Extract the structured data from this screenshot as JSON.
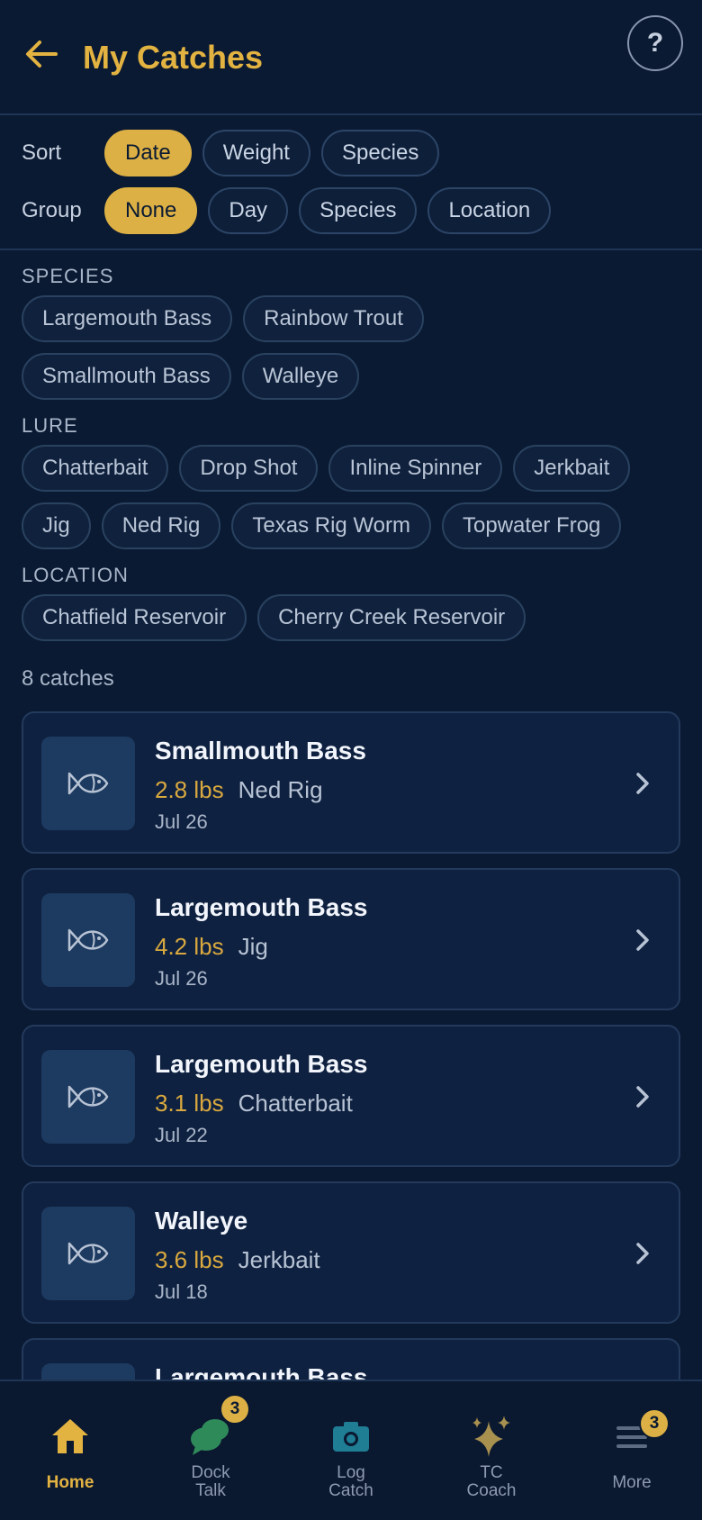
{
  "header": {
    "title": "My Catches",
    "help_label": "?"
  },
  "controls": {
    "sort": {
      "label": "Sort",
      "options": [
        "Date",
        "Weight",
        "Species"
      ],
      "selected": "Date"
    },
    "group": {
      "label": "Group",
      "options": [
        "None",
        "Day",
        "Species",
        "Location"
      ],
      "selected": "None"
    }
  },
  "filters": {
    "species": {
      "label": "SPECIES",
      "chips": [
        "Largemouth Bass",
        "Rainbow Trout",
        "Smallmouth Bass",
        "Walleye"
      ]
    },
    "lure": {
      "label": "LURE",
      "chips": [
        "Chatterbait",
        "Drop Shot",
        "Inline Spinner",
        "Jerkbait",
        "Jig",
        "Ned Rig",
        "Texas Rig Worm",
        "Topwater Frog"
      ]
    },
    "location": {
      "label": "LOCATION",
      "chips": [
        "Chatfield Reservoir",
        "Cherry Creek Reservoir"
      ]
    }
  },
  "catch_count": "8 catches",
  "catches": [
    {
      "species": "Smallmouth Bass",
      "weight": "2.8 lbs",
      "lure": "Ned Rig",
      "date": "Jul 26"
    },
    {
      "species": "Largemouth Bass",
      "weight": "4.2 lbs",
      "lure": "Jig",
      "date": "Jul 26"
    },
    {
      "species": "Largemouth Bass",
      "weight": "3.1 lbs",
      "lure": "Chatterbait",
      "date": "Jul 22"
    },
    {
      "species": "Walleye",
      "weight": "3.6 lbs",
      "lure": "Jerkbait",
      "date": "Jul 18"
    },
    {
      "species": "Largemouth Bass",
      "weight": "",
      "lure": "",
      "date": ""
    }
  ],
  "nav": {
    "items": [
      {
        "label1": "Home",
        "label2": "",
        "icon": "home-icon",
        "color": "#e3b341"
      },
      {
        "label1": "Dock",
        "label2": "Talk",
        "icon": "chat-icon",
        "badge": "3",
        "color": "#2f8a5a"
      },
      {
        "label1": "Log",
        "label2": "Catch",
        "icon": "camera-icon",
        "color": "#1f7d94"
      },
      {
        "label1": "TC",
        "label2": "Coach",
        "icon": "sparkle-icon",
        "color": "#a8904f"
      },
      {
        "label1": "More",
        "label2": "",
        "icon": "menu-icon",
        "badge": "3",
        "color": "#5d6b82"
      }
    ],
    "active": "Home"
  },
  "colors": {
    "background": "#0b1a33",
    "accent": "#e3b341",
    "card": "#0f2140"
  }
}
